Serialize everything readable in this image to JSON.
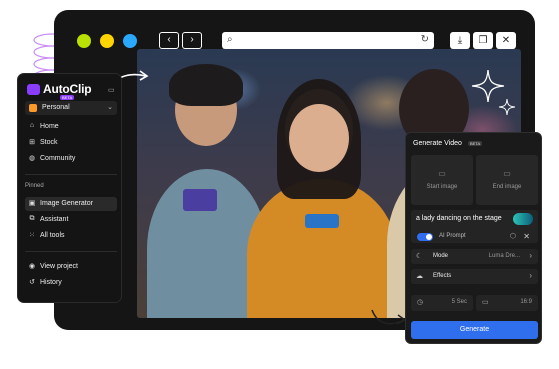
{
  "browser": {
    "window_dots": [
      "#b8e000",
      "#ffd400",
      "#2aa8ff"
    ],
    "nav_icons": {
      "back": "chevron-left-icon",
      "forward": "chevron-right-icon"
    },
    "url_icons": {
      "search": "search-icon",
      "reload": "reload-icon"
    },
    "toolbar_icons": [
      "download-icon",
      "copy-icon",
      "close-icon"
    ]
  },
  "sidebar": {
    "logo_text": "AutoClip",
    "logo_sub": "BETA",
    "workspace": {
      "name": "Personal"
    },
    "nav": [
      {
        "label": "Home",
        "icon": "home-icon"
      },
      {
        "label": "Stock",
        "icon": "stock-icon"
      },
      {
        "label": "Community",
        "icon": "globe-icon"
      }
    ],
    "pinned_title": "Pinned",
    "pinned": [
      {
        "label": "Image Generator",
        "icon": "image-icon"
      },
      {
        "label": "Assistant",
        "icon": "assistant-icon"
      },
      {
        "label": "All tools",
        "icon": "grid-icon"
      }
    ],
    "footer": [
      {
        "label": "View project",
        "icon": "eye-icon"
      },
      {
        "label": "History",
        "icon": "history-icon"
      }
    ]
  },
  "panel": {
    "title": "Generate Video",
    "badge": "BETA",
    "start_image": "Start image",
    "end_image": "End image",
    "prompt_text": "a lady dancing on the stage",
    "ai_prompt_label": "AI Prompt",
    "mode": {
      "label": "Mode",
      "value": "Luma Dre..."
    },
    "effects": {
      "label": "Effects"
    },
    "duration": "5 Sec",
    "ratio": "16:9",
    "generate_label": "Generate"
  },
  "colors": {
    "accent": "#2f6fed",
    "brand": "#8b3dff"
  }
}
